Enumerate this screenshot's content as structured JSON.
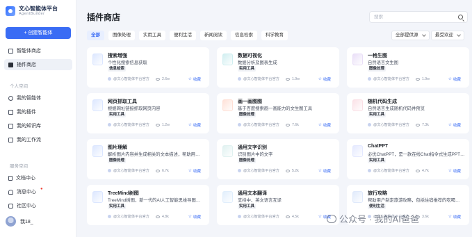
{
  "brand": {
    "name": "文心智能体平台",
    "sub": "AgentBuilder"
  },
  "sidebar": {
    "create_label": "+ 创建智能体",
    "top_items": [
      {
        "label": "智能体商店",
        "icon": "home-icon"
      },
      {
        "label": "插件商店",
        "icon": "plugin-icon"
      }
    ],
    "personal_label": "个人空间",
    "personal_items": [
      {
        "label": "我的智能体",
        "icon": "agent-icon"
      },
      {
        "label": "我的插件",
        "icon": "plugin-box-icon"
      },
      {
        "label": "我的知识库",
        "icon": "knowledge-icon"
      },
      {
        "label": "我的工作流",
        "icon": "workflow-icon"
      }
    ],
    "service_label": "服务空间",
    "service_items": [
      {
        "label": "文档中心",
        "icon": "doc-icon"
      },
      {
        "label": "消息中心",
        "icon": "bell-icon",
        "badge": "●"
      },
      {
        "label": "社区中心",
        "icon": "community-icon"
      }
    ],
    "user_name": "我18_"
  },
  "header": {
    "title": "插件商店",
    "search_placeholder": "搜索"
  },
  "tabs": [
    "全部",
    "图像处理",
    "实用工具",
    "便利生活",
    "新闻阅读",
    "信息检索",
    "科学教育"
  ],
  "filters": {
    "source": "全部提供源",
    "sort": "最受欢迎"
  },
  "cards": [
    {
      "title": "搜索增强",
      "desc": "个性化搜索信息获取",
      "tag": "信息检索",
      "provider": "文心智能体平台官方",
      "views": "2.6w",
      "fav": "收藏",
      "color": "#dbe6ff"
    },
    {
      "title": "数据可视化",
      "desc": "数据分析及图表生成",
      "tag": "实用工具",
      "provider": "文心智能体平台官方",
      "views": "1.9w",
      "fav": "收藏",
      "color": "#cfeef0"
    },
    {
      "title": "一格生图",
      "desc": "自然语言文生图",
      "tag": "图像处理",
      "provider": "文心智能体平台官方",
      "views": "1.9w",
      "fav": "收藏",
      "color": "#e9def7"
    },
    {
      "title": "网页抓取工具",
      "desc": "根据网址链接抓取网页内容",
      "tag": "实用工具",
      "provider": "文心智能体平台官方",
      "views": "1.2w",
      "fav": "收藏",
      "color": "#dbe6ff"
    },
    {
      "title": "画一画图图",
      "desc": "基于百度搜索画一画能力的文生图工具",
      "tag": "图像处理",
      "provider": "文心智能体平台官方",
      "views": "7.6k",
      "fav": "收藏",
      "color": "#ffe0d6"
    },
    {
      "title": "随机代码生成",
      "desc": "自然语言生成随机代码并预览",
      "tag": "实用工具",
      "provider": "文心智能体平台官方",
      "views": "7.3k",
      "fav": "收藏",
      "color": "#fbe0e6"
    },
    {
      "title": "图片理解",
      "desc": "解析图片内容并生成相关的文本描述，帮助用…",
      "tag": "图像处理",
      "provider": "文心智能体平台官方",
      "views": "6.7k",
      "fav": "收藏",
      "color": "#dbe6ff"
    },
    {
      "title": "通用文字识别",
      "desc": "识别图片中的文字",
      "tag": "图像处理",
      "provider": "文心智能体平台官方",
      "views": "5.2k",
      "fav": "收藏",
      "color": "#dff1f0"
    },
    {
      "title": "ChatPPT",
      "desc": "必优ChatPPT，是一款在线Chat指令式生成PPT…",
      "tag": "实用工具",
      "provider": "文心智能体平台官方",
      "views": "4.7k",
      "fav": "收藏",
      "color": "#e3e8ff"
    },
    {
      "title": "TreeMind树图",
      "desc": "TreeMind树图，新一代的AI人工智能思维导图…",
      "tag": "实用工具",
      "provider": "文心智能体平台官方",
      "views": "4.8k",
      "fav": "收藏",
      "color": "#dbe6ff"
    },
    {
      "title": "通用文本翻译",
      "desc": "支持中、英文语言互译",
      "tag": "实用工具",
      "provider": "文心智能体平台官方",
      "views": "4.5k",
      "fav": "收藏",
      "color": "#e0eefc"
    },
    {
      "title": "旅行攻略",
      "desc": "帮助用户制定旅游攻略，包括住宿推荐的吃喝…",
      "tag": "便利生活",
      "provider": "文心智能体平台官方",
      "views": "3.6k",
      "fav": "收藏",
      "color": "#dfe9fb"
    }
  ],
  "watermark": "公众号 · 我的AI爸爸"
}
